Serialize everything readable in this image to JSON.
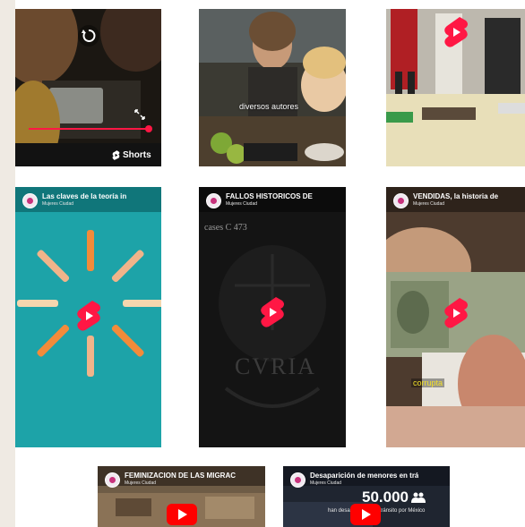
{
  "tiles_row1": [
    {
      "overlay_label": "Shorts",
      "icons": [
        "replay-icon",
        "fullscreen-icon",
        "shorts-small-icon"
      ]
    },
    {
      "caption": "diversos autores"
    },
    {}
  ],
  "tiles_row2": [
    {
      "title": "Las claves de la teoría in",
      "channel": "Mujeres Ciudad"
    },
    {
      "title": "FALLOS HISTÓRICOS DE",
      "channel": "Mujeres Ciudad",
      "case_text": "cases C 473",
      "seal_text": "CVRIA"
    },
    {
      "title": "VENDIDAS, la historia de",
      "channel": "Mujeres Ciudad",
      "caption": "corrupta"
    }
  ],
  "tiles_row3": [
    {
      "title": "FEMINIZACIÓN DE LAS MIGRAC",
      "channel": "Mujeres Ciudad"
    },
    {
      "title": "Desaparición de menores en trá",
      "channel": "Mujeres Ciudad",
      "big_number": "50.000",
      "caption": "han desaparecido en tránsito por México"
    }
  ],
  "colors": {
    "shorts_red": "#ff1744",
    "youtube_red": "#ff0000",
    "teal": "#1da3a8"
  }
}
